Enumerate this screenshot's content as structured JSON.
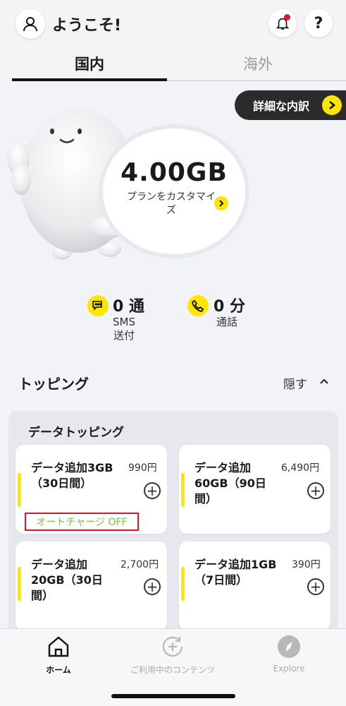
{
  "header": {
    "welcome": "ようこそ!",
    "help_label": "?"
  },
  "tabs": [
    {
      "label": "国内",
      "active": true
    },
    {
      "label": "海外",
      "active": false
    }
  ],
  "breakdown_label": "詳細な内訳",
  "data_balance": {
    "amount": "4.00GB",
    "customize_label": "プランをカスタマイズ"
  },
  "counters": {
    "sms": {
      "value": "0 通",
      "label": "SMS\n送付"
    },
    "call": {
      "value": "0 分",
      "label": "通話"
    }
  },
  "topping": {
    "title": "トッピング",
    "hide_label": "隠す",
    "section_title": "データトッピング",
    "items": [
      {
        "name": "データ追加3GB\n（30日間）",
        "price": "990円",
        "auto_charge": "オートチャージ OFF"
      },
      {
        "name": "データ追加\n60GB（90日\n間）",
        "price": "6,490円"
      },
      {
        "name": "データ追加\n20GB（30日\n間）",
        "price": "2,700円"
      },
      {
        "name": "データ追加1GB\n（7日間）",
        "price": "390円"
      }
    ]
  },
  "nav": {
    "home": "ホーム",
    "content": "ご利用中のコンテンツ",
    "explore": "Explore"
  },
  "colors": {
    "accent": "#ffe600",
    "notification": "#e8112d",
    "auto_charge_text": "#79c24a",
    "auto_charge_border": "#e1152a",
    "dark_pill": "#2b2b2b"
  },
  "icons": [
    "user-icon",
    "bell-icon",
    "help-icon",
    "chevron-right-icon",
    "sms-icon",
    "phone-icon",
    "chevron-up-icon",
    "plus-icon",
    "home-icon",
    "refresh-plus-icon",
    "compass-icon"
  ]
}
